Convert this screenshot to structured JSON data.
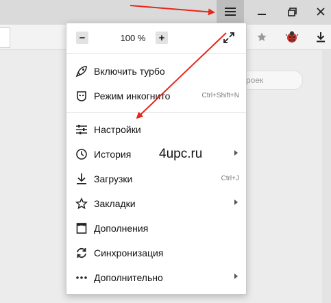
{
  "menu": {
    "zoom": {
      "minus": "−",
      "value": "100 %",
      "plus": "+"
    },
    "items": [
      {
        "label": "Включить турбо",
        "icon": "rocket-icon"
      },
      {
        "label": "Режим инкогнито",
        "shortcut": "Ctrl+Shift+N",
        "icon": "incognito-icon"
      },
      {
        "label": "Настройки",
        "icon": "settings-sliders-icon"
      },
      {
        "label": "История",
        "icon": "clock-icon",
        "submenu": true
      },
      {
        "label": "Загрузки",
        "shortcut": "Ctrl+J",
        "icon": "download-icon"
      },
      {
        "label": "Закладки",
        "icon": "star-icon",
        "submenu": true
      },
      {
        "label": "Дополнения",
        "icon": "extensions-icon"
      },
      {
        "label": "Синхронизация",
        "icon": "sync-icon"
      },
      {
        "label": "Дополнительно",
        "icon": "more-dots-icon",
        "submenu": true
      }
    ]
  },
  "page": {
    "search_fragment": "роек"
  },
  "watermark": "4upc.ru",
  "colors": {
    "annotation_arrow": "#e8261c",
    "menu_button_active": "#bdbdbd"
  }
}
